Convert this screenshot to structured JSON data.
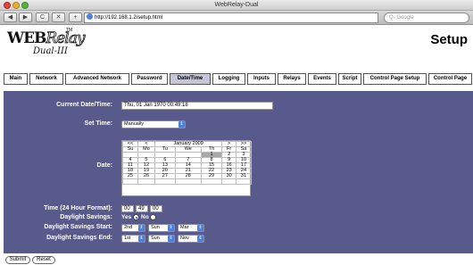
{
  "window": {
    "title": "WebRelay-Dual"
  },
  "browser": {
    "back": "◀",
    "forward": "▶",
    "reload": "C",
    "bookmarks": "✕",
    "add": "+",
    "url": "http://192.168.1.2/setup.html",
    "search_placeholder": "Q- Google"
  },
  "header": {
    "logo_main": "WEB",
    "logo_relay": "Relay",
    "logo_tm": "TM",
    "logo_sub": "Dual-III",
    "page_title": "Setup"
  },
  "nav": {
    "tabs": [
      {
        "label": "Main"
      },
      {
        "label": "Network"
      },
      {
        "label": "Advanced Network"
      },
      {
        "label": "Password"
      },
      {
        "label": "Date/Time"
      },
      {
        "label": "Logging"
      },
      {
        "label": "Inputs"
      },
      {
        "label": "Relays"
      },
      {
        "label": "Events"
      },
      {
        "label": "Script"
      },
      {
        "label": "Control Page Setup"
      },
      {
        "label": "Control Page"
      }
    ],
    "active": "Date/Time"
  },
  "form": {
    "current_datetime_label": "Current Date/Time:",
    "current_datetime_value": "Thu, 01 Jan 1970 00:49:18",
    "set_time_label": "Set Time:",
    "set_time_value": "Manually",
    "date_label": "Date:",
    "calendar": {
      "nav_prev_year": "<<",
      "nav_prev_month": "<",
      "month_title": "January 2009",
      "nav_next_month": ">",
      "nav_next_year": ">>",
      "weekdays": [
        "Su",
        "Mo",
        "Tu",
        "We",
        "Th",
        "Fr",
        "Sa"
      ],
      "weeks": [
        [
          "",
          "",
          "",
          "",
          "1",
          "2",
          "3"
        ],
        [
          "4",
          "5",
          "6",
          "7",
          "8",
          "9",
          "10"
        ],
        [
          "11",
          "12",
          "13",
          "14",
          "15",
          "16",
          "17"
        ],
        [
          "18",
          "19",
          "20",
          "21",
          "22",
          "23",
          "24"
        ],
        [
          "25",
          "26",
          "27",
          "28",
          "29",
          "30",
          "31"
        ],
        [
          "",
          "",
          "",
          "",
          "",
          "",
          ""
        ]
      ],
      "selected_day": "1"
    },
    "time_label": "Time (24 Hour Format):",
    "time_hours": "00",
    "time_minutes": "49",
    "time_seconds": "00",
    "daylight_label": "Daylight Savings:",
    "daylight_yes": "Yes",
    "daylight_no": "No",
    "daylight_selected": "Yes",
    "dst_start_label": "Daylight Savings Start:",
    "dst_start": {
      "week": "2nd",
      "day": "Sun",
      "month": "Mar"
    },
    "dst_end_label": "Daylight Savings End:",
    "dst_end": {
      "week": "1st",
      "day": "Sun",
      "month": "Nov"
    }
  },
  "buttons": {
    "submit": "Submit",
    "reset": "Reset"
  },
  "colors": {
    "panel": "#585a8b",
    "active_tab": "#c6c6d9",
    "selected_day": "#a8a8a8"
  }
}
